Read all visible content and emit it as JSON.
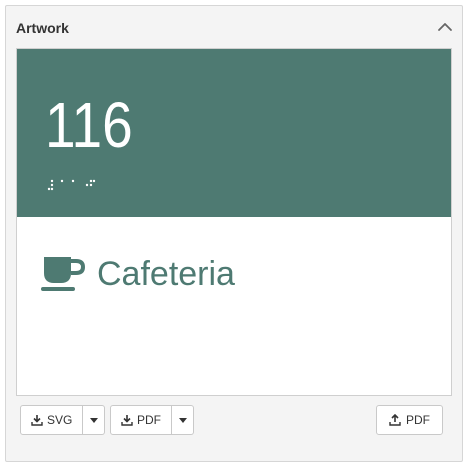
{
  "panel": {
    "title": "Artwork",
    "collapse_icon": "chevron-up-icon"
  },
  "sign": {
    "room_number": "116",
    "room_name": "Cafeteria",
    "room_icon": "coffee-cup-icon",
    "colors": {
      "panel_band": "#4e7a72",
      "number_text": "#ffffff",
      "name_text": "#4e7a72"
    }
  },
  "toolbar": {
    "download_svg_label": "SVG",
    "download_pdf_label": "PDF",
    "upload_pdf_label": "PDF",
    "download_icon": "download-icon",
    "upload_icon": "upload-icon",
    "caret_icon": "caret-down-icon"
  }
}
